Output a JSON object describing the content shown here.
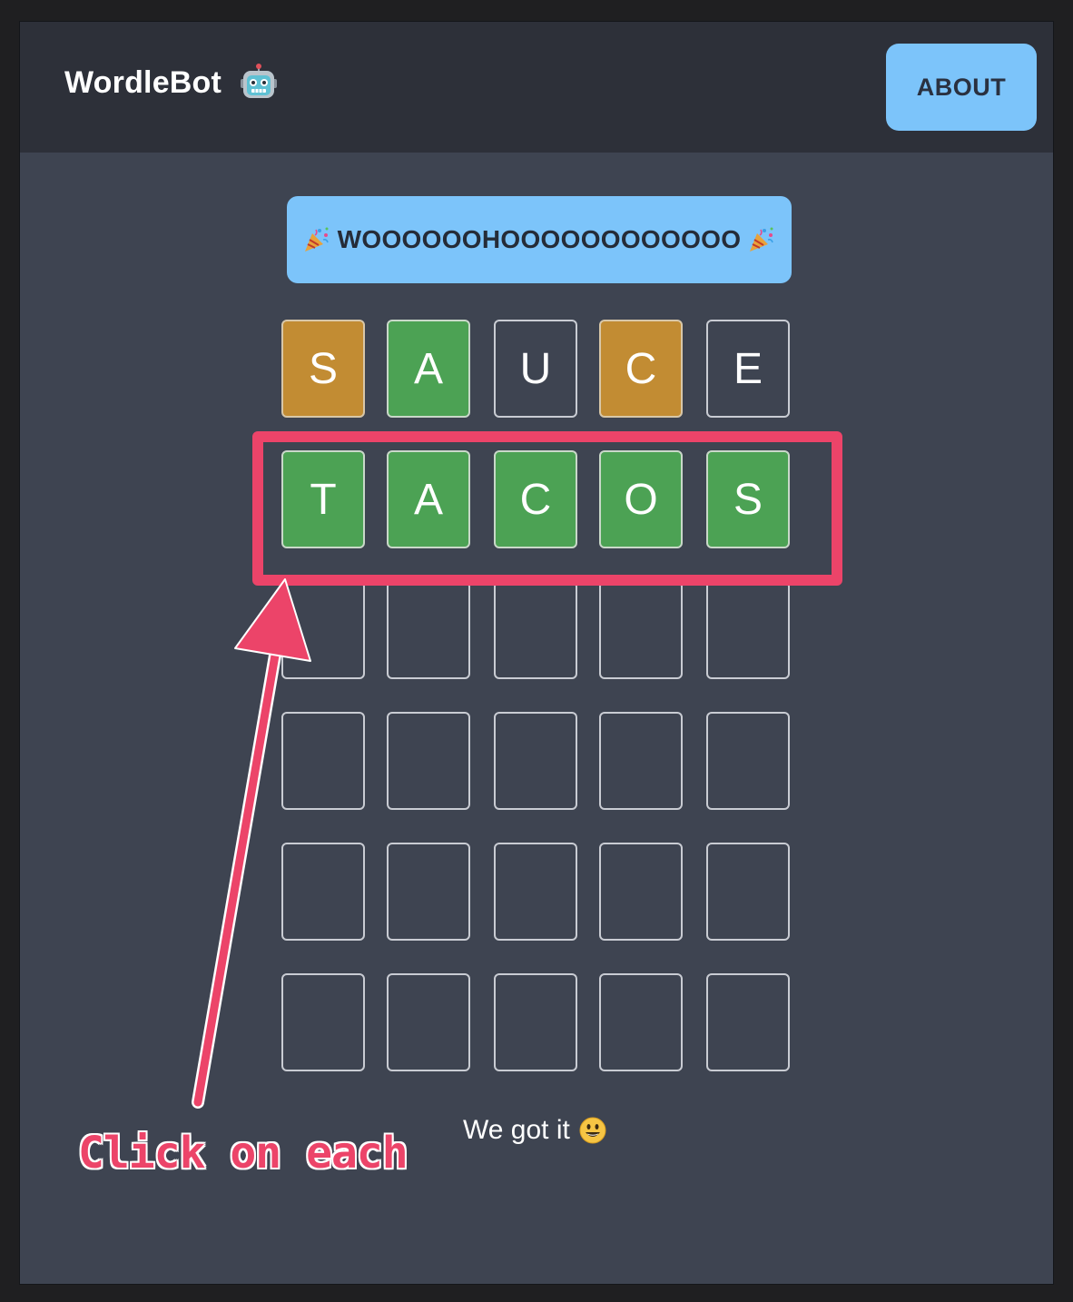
{
  "header": {
    "title": "WordleBot",
    "logo_icon": "robot-icon",
    "about_label": "ABOUT"
  },
  "banner": {
    "text": "WOOOOOOHOOOOOOOOOOOO",
    "icon": "party-popper-icon"
  },
  "grid": {
    "rows": [
      [
        {
          "letter": "S",
          "state": "yellow"
        },
        {
          "letter": "A",
          "state": "green"
        },
        {
          "letter": "U",
          "state": "empty"
        },
        {
          "letter": "C",
          "state": "yellow"
        },
        {
          "letter": "E",
          "state": "empty"
        }
      ],
      [
        {
          "letter": "T",
          "state": "green"
        },
        {
          "letter": "A",
          "state": "green"
        },
        {
          "letter": "C",
          "state": "green"
        },
        {
          "letter": "O",
          "state": "green"
        },
        {
          "letter": "S",
          "state": "green"
        }
      ],
      [
        {
          "letter": "",
          "state": "empty"
        },
        {
          "letter": "",
          "state": "empty"
        },
        {
          "letter": "",
          "state": "empty"
        },
        {
          "letter": "",
          "state": "empty"
        },
        {
          "letter": "",
          "state": "empty"
        }
      ],
      [
        {
          "letter": "",
          "state": "empty"
        },
        {
          "letter": "",
          "state": "empty"
        },
        {
          "letter": "",
          "state": "empty"
        },
        {
          "letter": "",
          "state": "empty"
        },
        {
          "letter": "",
          "state": "empty"
        }
      ],
      [
        {
          "letter": "",
          "state": "empty"
        },
        {
          "letter": "",
          "state": "empty"
        },
        {
          "letter": "",
          "state": "empty"
        },
        {
          "letter": "",
          "state": "empty"
        },
        {
          "letter": "",
          "state": "empty"
        }
      ],
      [
        {
          "letter": "",
          "state": "empty"
        },
        {
          "letter": "",
          "state": "empty"
        },
        {
          "letter": "",
          "state": "empty"
        },
        {
          "letter": "",
          "state": "empty"
        },
        {
          "letter": "",
          "state": "empty"
        }
      ]
    ]
  },
  "status": {
    "text": "We got it",
    "icon": "smiley-icon"
  },
  "annotation": {
    "text": "Click on each"
  },
  "colors": {
    "green": "#4ca254",
    "yellow": "#c28c33",
    "accent": "#7cc4fa",
    "annotation": "#ec4469"
  }
}
